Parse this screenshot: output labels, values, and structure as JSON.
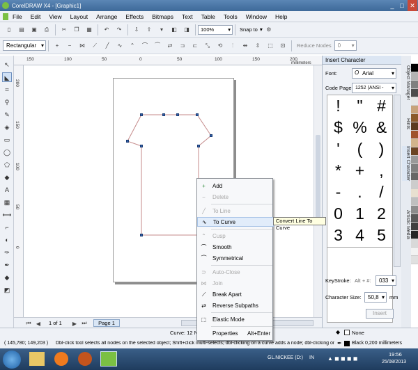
{
  "window": {
    "title": "CorelDRAW X4 - [Graphic1]",
    "min": "_",
    "max": "□",
    "close": "✕"
  },
  "menu": [
    "File",
    "Edit",
    "View",
    "Layout",
    "Arrange",
    "Effects",
    "Bitmaps",
    "Text",
    "Table",
    "Tools",
    "Window",
    "Help"
  ],
  "toolbar": {
    "zoom": "100%",
    "snap_to": "Snap to"
  },
  "property_bar": {
    "mode": "Rectangular",
    "reduce_nodes": "Reduce Nodes",
    "reduce_value": "0"
  },
  "ruler": {
    "units": "millimeters",
    "h_labels": [
      "150",
      "100",
      "50",
      "0",
      "50",
      "100",
      "150",
      "200"
    ],
    "v_labels": [
      "200",
      "150",
      "100",
      "50",
      "0"
    ]
  },
  "page_nav": {
    "counter": "1 of 1",
    "tab": "Page 1"
  },
  "context_menu": {
    "items": [
      {
        "label": "Add",
        "enabled": true
      },
      {
        "label": "Delete",
        "enabled": false
      },
      {
        "label": "To Line",
        "enabled": false
      },
      {
        "label": "To Curve",
        "enabled": true,
        "highlighted": true
      },
      {
        "label": "Cusp",
        "enabled": false
      },
      {
        "label": "Smooth",
        "enabled": true
      },
      {
        "label": "Symmetrical",
        "enabled": true
      },
      {
        "label": "Auto-Close",
        "enabled": false
      },
      {
        "label": "Join",
        "enabled": false
      },
      {
        "label": "Break Apart",
        "enabled": true
      },
      {
        "label": "Reverse Subpaths",
        "enabled": true
      },
      {
        "label": "Elastic Mode",
        "enabled": true
      },
      {
        "label": "Properties",
        "enabled": true,
        "shortcut": "Alt+Enter"
      }
    ],
    "tooltip": "Convert Line To Curve"
  },
  "insert_character": {
    "title": "Insert Character",
    "font_label": "Font:",
    "font_value": "Arial",
    "codepage_label": "Code Page:",
    "codepage_value": "1252 (ANSI -",
    "chars": [
      "!",
      "\"",
      "#",
      "$",
      "%",
      "&",
      "'",
      "(",
      ")",
      "*",
      "+",
      ",",
      "-",
      ".",
      "/",
      "0",
      "1",
      "2",
      "3",
      "4",
      "5"
    ],
    "keystroke_label": "KeyStroke:",
    "keystroke_prefix": "Alt + #:",
    "keystroke_value": "033",
    "size_label": "Character Size:",
    "size_value": "50,8",
    "size_unit": "mm",
    "insert_button": "Insert"
  },
  "side_tabs": [
    "Object Manager",
    "Hints",
    "Insert Character",
    "Artistic Media"
  ],
  "palette": [
    "#ffffff",
    "#000000",
    "#b3b3b3",
    "#808080",
    "#4d4d4d",
    "#e6e6e6",
    "#c7a27a",
    "#8b5a2b",
    "#5c3a1e",
    "#a0522d",
    "#d2b48c",
    "#6b4423",
    "#999999",
    "#7f7f7f",
    "#666666",
    "#cccccc",
    "#e8e0d0",
    "#bfbfbf",
    "#8c8c8c",
    "#595959",
    "#404040",
    "#262626",
    "#d9d9d9",
    "#f2f2f2",
    "#e0e0e0"
  ],
  "status": {
    "curve": "Curve: 12 Nodes",
    "fill": "None",
    "coords": "( 145,780; 149,203 )",
    "hint": "Dbl-click tool selects all nodes on the selected object; Shift+click multi-selects; dbl-clicking on a curve adds a node; dbl-clicking on a node remo...",
    "outline": "Black  0,200 millimeters"
  },
  "taskbar": {
    "drive": "GL.NICKEE (D:)",
    "lang": "IN",
    "time": "19:56",
    "date": "25/08/2013"
  },
  "colors": {
    "title": "#4a77a8",
    "accent": "#2f5fa8",
    "highlight": "#e1ecfa"
  }
}
